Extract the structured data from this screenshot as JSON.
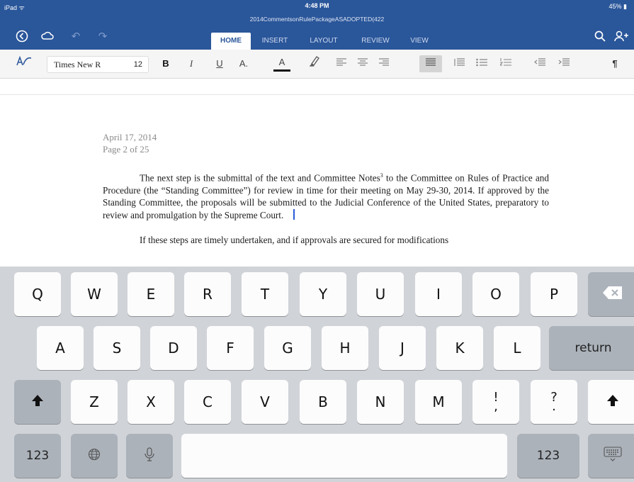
{
  "status": {
    "carrier": "iPad ᯤ",
    "time": "4:48 PM",
    "battery": "45%"
  },
  "document": {
    "filename": "2014CommentsonRulePackageASADOPTED(422"
  },
  "header": {
    "back_icon": "back-circle-icon",
    "save_icon": "cloud-sync-icon",
    "undo_icon": "undo-icon",
    "redo_icon": "redo-icon",
    "search_icon": "search-icon",
    "share_icon": "add-person-icon",
    "tabs": [
      "HOME",
      "INSERT",
      "LAYOUT",
      "REVIEW",
      "VIEW"
    ],
    "active_tab": "HOME"
  },
  "toolbar": {
    "font_name": "Times New R",
    "font_size": "12",
    "bold": "B",
    "italic": "I",
    "underline": "U",
    "text_style": "A.",
    "font_color": "A"
  },
  "page": {
    "date": "April 17, 2014",
    "page_label": "Page 2 of 25",
    "para1_start": "The next step is the submittal of the text and Committee Notes",
    "para1_sup": "3",
    "para1_rest": " to the Committee on Rules of Practice and Procedure (the “Standing Committee”) for review in time for their meeting on May 29-30, 2014.   If approved by the Standing Committee, the proposals will be submitted to the Judicial Conference of the United States, preparatory to review and promulgation by the Supreme Court.",
    "para2": "If these steps are timely undertaken, and if approvals are secured for modifications"
  },
  "keyboard": {
    "row1": [
      "Q",
      "W",
      "E",
      "R",
      "T",
      "Y",
      "U",
      "I",
      "O",
      "P"
    ],
    "row2": [
      "A",
      "S",
      "D",
      "F",
      "G",
      "H",
      "J",
      "K",
      "L"
    ],
    "row3": [
      "Z",
      "X",
      "C",
      "V",
      "B",
      "N",
      "M"
    ],
    "punct1": [
      "!",
      ","
    ],
    "punct2": [
      "?",
      "."
    ],
    "return_label": "return",
    "numbers_label": "123",
    "backspace_icon": "backspace-icon",
    "shift_icon": "shift-icon",
    "globe_icon": "globe-icon",
    "mic_icon": "microphone-icon",
    "dismiss_icon": "keyboard-dismiss-icon"
  }
}
